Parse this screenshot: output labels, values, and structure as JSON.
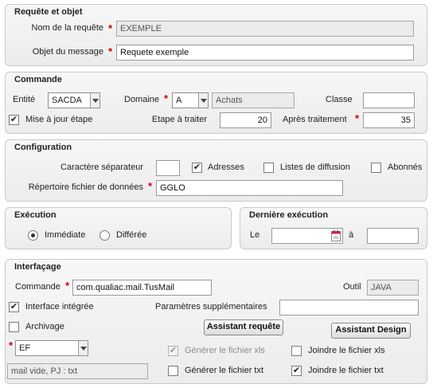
{
  "requete": {
    "title": "Requête et objet",
    "nom_label": "Nom de la requête",
    "nom_value": "EXEMPLE",
    "objet_label": "Objet du message",
    "objet_value": "Requete exemple"
  },
  "commande": {
    "title": "Commande",
    "entite_label": "Entité",
    "entite_value": "SACDA",
    "domaine_label": "Domaine",
    "domaine_value": "A",
    "domaine_desc": "Achats",
    "classe_label": "Classe",
    "classe_value": "",
    "maj_label": "Mise à jour étape",
    "maj_checked": "✔",
    "etape_label": "Etape à traiter",
    "etape_value": "20",
    "apres_label": "Après traitement",
    "apres_value": "35"
  },
  "configuration": {
    "title": "Configuration",
    "sep_label": "Caractère séparateur",
    "sep_value": "",
    "adresses_label": "Adresses",
    "adresses_checked": "✔",
    "listes_label": "Listes de diffusion",
    "abonnes_label": "Abonnés",
    "rep_label": "Répertoire fichier de données",
    "rep_value": "GGLO"
  },
  "execution": {
    "title": "Exécution",
    "immediate_label": "Immédiate",
    "differee_label": "Différée"
  },
  "derniere": {
    "title": "Dernière exécution",
    "le_label": "Le",
    "le_value": "",
    "a_label": "à",
    "a_value": ""
  },
  "interfacage": {
    "title": "Interfaçage",
    "commande_label": "Commande",
    "commande_value": "com.qualiac.mail.TusMail",
    "outil_label": "Outil",
    "outil_value": "JAVA",
    "integree_label": "Interface intégrée",
    "integree_checked": "✔",
    "params_label": "Paramètres supplémentaires",
    "params_value": "",
    "archivage_label": "Archivage",
    "assistant_requete": "Assistant requête",
    "assistant_design": "Assistant Design",
    "format_value": "EF",
    "generer_xls_label": "Générer le fichier xls",
    "generer_xls_checked": "✔",
    "joindre_xls_label": "Joindre le fichier xls",
    "generer_txt_label": "Générer le fichier txt",
    "joindre_txt_label": "Joindre le fichier txt",
    "joindre_txt_checked": "✔",
    "status_value": "mail vide, PJ : txt"
  },
  "colors": {
    "required": "#cc0000",
    "border": "#c9c9c9"
  }
}
